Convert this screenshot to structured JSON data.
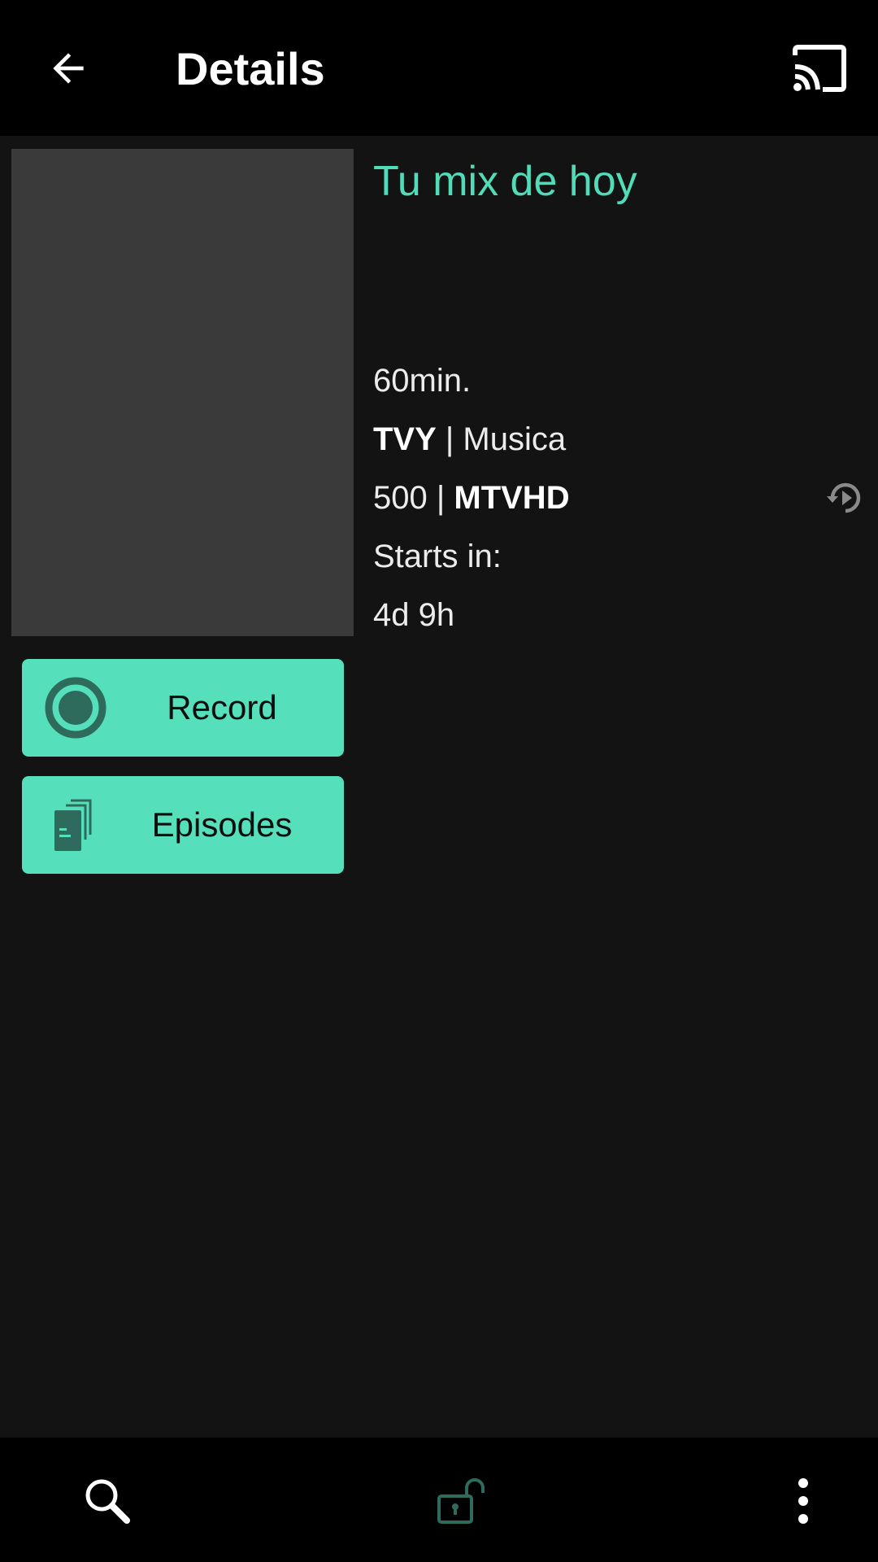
{
  "header": {
    "title": "Details",
    "back_icon": "arrow-left-icon",
    "cast_icon": "cast-icon"
  },
  "program": {
    "title": "Tu mix de hoy",
    "duration": "60min.",
    "rating": "TVY",
    "separator": " | ",
    "genre": "Musica",
    "channel_number": "500",
    "channel_name": "MTVHD",
    "starts_label": "Starts in:",
    "starts_value": "4d 9h"
  },
  "actions": {
    "record_label": "Record",
    "episodes_label": "Episodes"
  },
  "bottom_nav": {
    "search_icon": "search-icon",
    "lock_icon": "unlock-icon",
    "more_icon": "more-vert-icon"
  },
  "colors": {
    "accent": "#56dfbb",
    "title": "#52dbb7",
    "background": "#131313",
    "bar": "#000000",
    "poster_placeholder": "#3a3a3a"
  }
}
